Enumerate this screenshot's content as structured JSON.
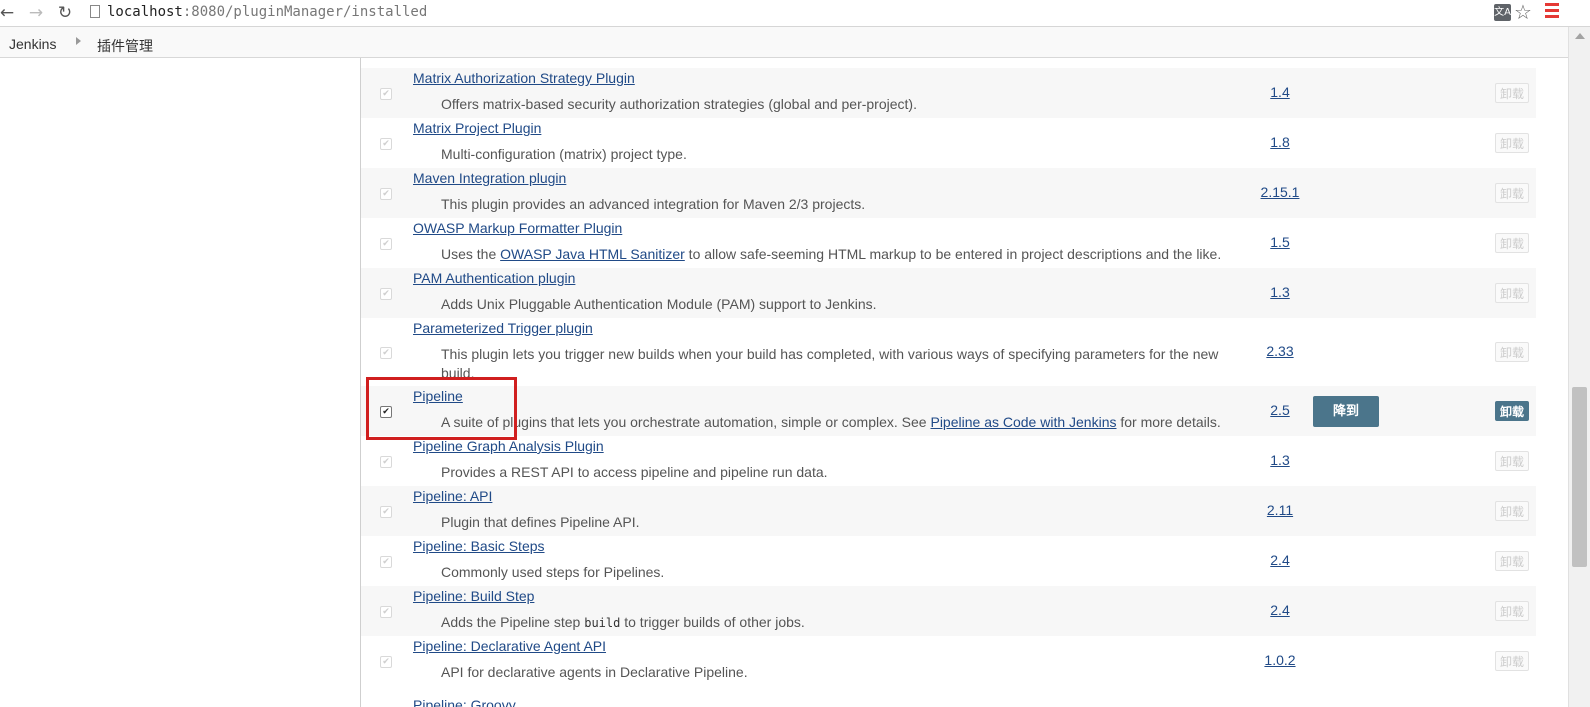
{
  "browser": {
    "url_host": "localhost",
    "url_path": ":8080/pluginManager/installed",
    "translate_glyph": "文A"
  },
  "breadcrumb": {
    "items": [
      "Jenkins",
      "插件管理"
    ]
  },
  "buttons": {
    "uninstall_label": "卸载",
    "downgrade_label": "降到"
  },
  "plugins": [
    {
      "name": "Matrix Authorization Strategy Plugin",
      "desc_before": "Offers matrix-based security authorization strategies (global and per-project).",
      "link": "",
      "desc_after": "",
      "version": "1.4"
    },
    {
      "name": "Matrix Project Plugin",
      "desc_before": "Multi-configuration (matrix) project type.",
      "link": "",
      "desc_after": "",
      "version": "1.8"
    },
    {
      "name": "Maven Integration plugin",
      "desc_before": "This plugin provides an advanced integration for Maven 2/3 projects.",
      "link": "",
      "desc_after": "",
      "version": "2.15.1"
    },
    {
      "name": "OWASP Markup Formatter Plugin",
      "desc_before": "Uses the ",
      "link": "OWASP Java HTML Sanitizer",
      "desc_after": " to allow safe-seeming HTML markup to be entered in project descriptions and the like.",
      "version": "1.5"
    },
    {
      "name": "PAM Authentication plugin",
      "desc_before": "Adds Unix Pluggable Authentication Module (PAM) support to Jenkins.",
      "link": "",
      "desc_after": "",
      "version": "1.3"
    },
    {
      "name": "Parameterized Trigger plugin",
      "desc_before": "This plugin lets you trigger new builds when your build has completed, with various ways of specifying parameters for the new build.",
      "link": "",
      "desc_after": "",
      "version": "2.33"
    },
    {
      "name": "Pipeline",
      "desc_before": "A suite of plugins that lets you orchestrate automation, simple or complex. See ",
      "link": "Pipeline as Code with Jenkins",
      "desc_after": " for more details.",
      "version": "2.5"
    },
    {
      "name": "Pipeline Graph Analysis Plugin",
      "desc_before": "Provides a REST API to access pipeline and pipeline run data.",
      "link": "",
      "desc_after": "",
      "version": "1.3"
    },
    {
      "name": "Pipeline: API",
      "desc_before": "Plugin that defines Pipeline API.",
      "link": "",
      "desc_after": "",
      "version": "2.11"
    },
    {
      "name": "Pipeline: Basic Steps",
      "desc_before": "Commonly used steps for Pipelines.",
      "link": "",
      "desc_after": "",
      "version": "2.4"
    },
    {
      "name": "Pipeline: Build Step",
      "desc_before": "Adds the Pipeline step ",
      "code": "build",
      "desc_after": " to trigger builds of other jobs.",
      "version": "2.4"
    },
    {
      "name": "Pipeline: Declarative Agent API",
      "desc_before": "API for declarative agents in Declarative Pipeline.",
      "link": "",
      "desc_after": "",
      "version": "1.0.2"
    }
  ],
  "partial_next": "Pipeline: Groovy"
}
